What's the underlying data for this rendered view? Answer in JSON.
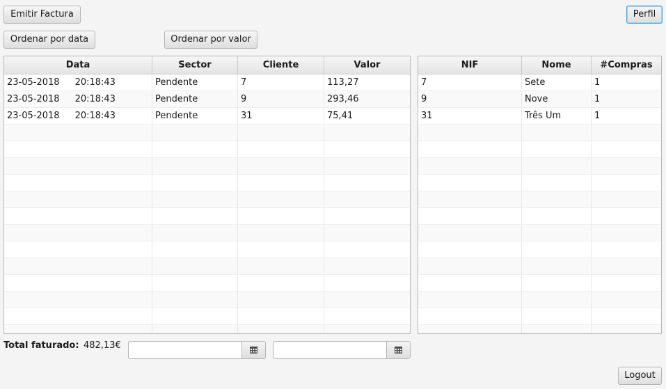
{
  "toolbar": {
    "emitir_factura": "Emitir Factura",
    "perfil": "Perfil",
    "ordenar_data": "Ordenar por data",
    "ordenar_valor": "Ordenar por valor",
    "logout": "Logout"
  },
  "invoices": {
    "columns": [
      "Data",
      "Sector",
      "Cliente",
      "Valor"
    ],
    "rows": [
      {
        "date": "23-05-2018",
        "time": "20:18:43",
        "sector": "Pendente",
        "cliente": "7",
        "valor": "113,27"
      },
      {
        "date": "23-05-2018",
        "time": "20:18:43",
        "sector": "Pendente",
        "cliente": "9",
        "valor": "293,46"
      },
      {
        "date": "23-05-2018",
        "time": "20:18:43",
        "sector": "Pendente",
        "cliente": "31",
        "valor": "75,41"
      }
    ]
  },
  "clients": {
    "columns": [
      "NIF",
      "Nome",
      "#Compras"
    ],
    "rows": [
      {
        "nif": "7",
        "nome": "Sete",
        "compras": "1"
      },
      {
        "nif": "9",
        "nome": "Nove",
        "compras": "1"
      },
      {
        "nif": "31",
        "nome": "Três Um",
        "compras": "1"
      }
    ]
  },
  "footer": {
    "total_label": "Total faturado:",
    "total_value": "482,13€",
    "date_from": {
      "value": "",
      "icon": "calendar-icon"
    },
    "date_to": {
      "value": "",
      "icon": "calendar-icon"
    }
  },
  "colors": {
    "focus": "#3fa0e0"
  }
}
